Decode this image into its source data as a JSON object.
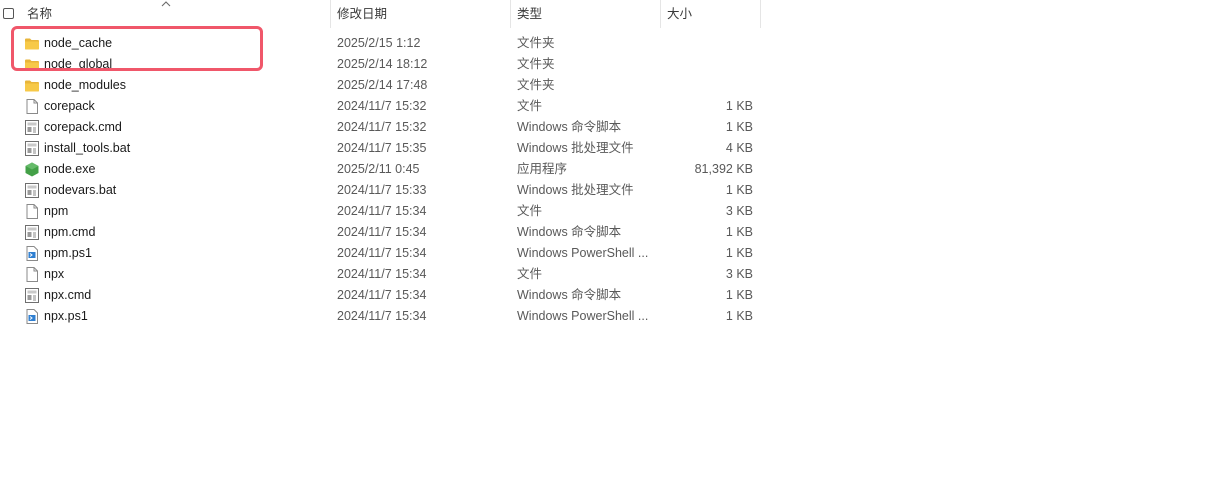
{
  "header": {
    "name_label": "名称",
    "date_label": "修改日期",
    "type_label": "类型",
    "size_label": "大小"
  },
  "colors": {
    "folder": "#f7c948",
    "highlight": "#f0576a",
    "node_green": "#43a047"
  },
  "files": [
    {
      "name": "node_cache",
      "date": "2025/2/15 1:12",
      "type": "文件夹",
      "size": "",
      "icon": "folder-icon"
    },
    {
      "name": "node_global",
      "date": "2025/2/14 18:12",
      "type": "文件夹",
      "size": "",
      "icon": "folder-icon"
    },
    {
      "name": "node_modules",
      "date": "2025/2/14 17:48",
      "type": "文件夹",
      "size": "",
      "icon": "folder-icon"
    },
    {
      "name": "corepack",
      "date": "2024/11/7 15:32",
      "type": "文件",
      "size": "1 KB",
      "icon": "file-icon"
    },
    {
      "name": "corepack.cmd",
      "date": "2024/11/7 15:32",
      "type": "Windows 命令脚本",
      "size": "1 KB",
      "icon": "script-icon"
    },
    {
      "name": "install_tools.bat",
      "date": "2024/11/7 15:35",
      "type": "Windows 批处理文件",
      "size": "4 KB",
      "icon": "script-icon"
    },
    {
      "name": "node.exe",
      "date": "2025/2/11 0:45",
      "type": "应用程序",
      "size": "81,392 KB",
      "icon": "node-exe-icon"
    },
    {
      "name": "nodevars.bat",
      "date": "2024/11/7 15:33",
      "type": "Windows 批处理文件",
      "size": "1 KB",
      "icon": "script-icon"
    },
    {
      "name": "npm",
      "date": "2024/11/7 15:34",
      "type": "文件",
      "size": "3 KB",
      "icon": "file-icon"
    },
    {
      "name": "npm.cmd",
      "date": "2024/11/7 15:34",
      "type": "Windows 命令脚本",
      "size": "1 KB",
      "icon": "script-icon"
    },
    {
      "name": "npm.ps1",
      "date": "2024/11/7 15:34",
      "type": "Windows PowerShell ...",
      "size": "1 KB",
      "icon": "powershell-icon"
    },
    {
      "name": "npx",
      "date": "2024/11/7 15:34",
      "type": "文件",
      "size": "3 KB",
      "icon": "file-icon"
    },
    {
      "name": "npx.cmd",
      "date": "2024/11/7 15:34",
      "type": "Windows 命令脚本",
      "size": "1 KB",
      "icon": "script-icon"
    },
    {
      "name": "npx.ps1",
      "date": "2024/11/7 15:34",
      "type": "Windows PowerShell ...",
      "size": "1 KB",
      "icon": "powershell-icon"
    }
  ]
}
